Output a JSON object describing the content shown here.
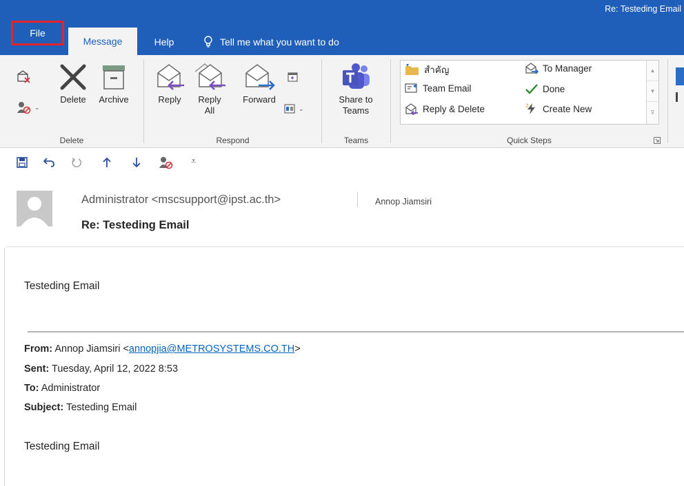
{
  "window": {
    "title": "Re: Testeding Email"
  },
  "tabs": {
    "file": "File",
    "message": "Message",
    "help": "Help",
    "tell_me": "Tell me what you want to do"
  },
  "ribbon": {
    "delete_group": {
      "label": "Delete",
      "delete_button": "Delete",
      "archive_button": "Archive"
    },
    "respond_group": {
      "label": "Respond",
      "reply": "Reply",
      "reply_all_line1": "Reply",
      "reply_all_line2": "All",
      "forward": "Forward"
    },
    "teams_group": {
      "label": "Teams",
      "share_line1": "Share to",
      "share_line2": "Teams"
    },
    "quick_steps": {
      "label": "Quick Steps",
      "items": [
        "สำคัญ",
        "Team Email",
        "Reply & Delete",
        "To Manager",
        "Done",
        "Create New"
      ]
    }
  },
  "message": {
    "sender": "Administrator <mscsupport@ipst.ac.th>",
    "recipient": "Annop Jiamsiri",
    "subject": "Re: Testeding Email",
    "body": "Testeding Email",
    "quoted": {
      "from_label": "From:",
      "from_name": "Annop Jiamsiri <",
      "from_email": "annopjia@METROSYSTEMS.CO.TH",
      "from_close": ">",
      "sent_label": "Sent:",
      "sent_value": "Tuesday, April 12, 2022 8:53",
      "to_label": "To:",
      "to_value": "Administrator",
      "subject_label": "Subject:",
      "subject_value": "Testeding Email",
      "body": "Testeding Email"
    }
  },
  "colors": {
    "accent": "#1f5fb9",
    "highlight_box": "#e3242b",
    "link": "#0563c1",
    "reply_arrow": "#7a4ec2",
    "forward_arrow": "#2b6cc4",
    "done_check": "#2e8b2e"
  }
}
